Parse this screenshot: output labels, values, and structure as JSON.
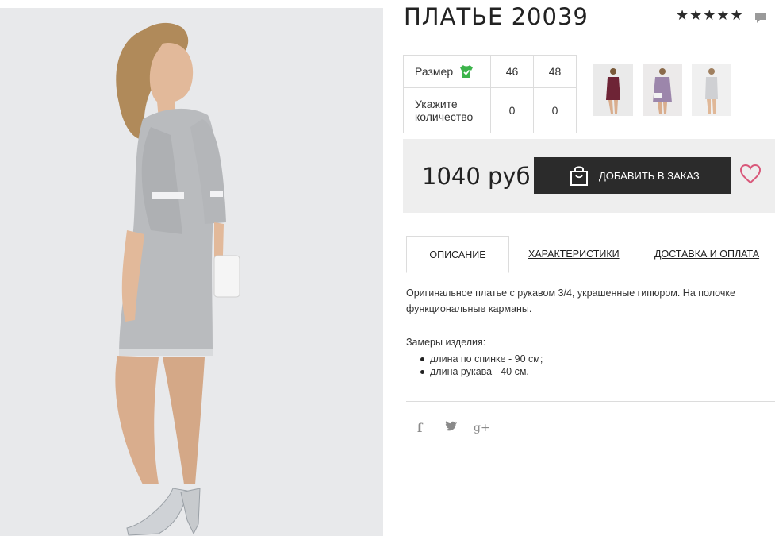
{
  "product": {
    "title": "ПЛАТЬЕ 20039",
    "rating_stars": "★★★★★",
    "rating_value": 5,
    "photo_icon": "model-in-grey-dress-photo"
  },
  "size_table": {
    "size_label": "Размер",
    "sizes": [
      "46",
      "48"
    ],
    "quantity_label": "Укажите количество",
    "quantities": [
      "0",
      "0"
    ]
  },
  "thumbnails": [
    {
      "icon": "burgundy-dress-thumbnail"
    },
    {
      "icon": "lilac-dress-thumbnail"
    },
    {
      "icon": "light-grey-dress-thumbnail"
    }
  ],
  "purchase": {
    "price": "1040 руб",
    "add_button_label": "ДОБАВИТЬ В ЗАКАЗ"
  },
  "tabs": [
    {
      "label": "ОПИСАНИЕ",
      "active": true
    },
    {
      "label": "ХАРАКТЕРИСТИКИ",
      "active": false
    },
    {
      "label": "ДОСТАВКА И ОПЛАТА",
      "active": false
    }
  ],
  "description": {
    "text": "Оригинальное платье с рукавом 3/4, украшенные гипюром. На полочке функциональные карманы.",
    "measures_title": "Замеры изделия:",
    "measures": [
      "длина по спинке - 90 см;",
      "длина рукава - 40 см."
    ]
  },
  "social": {
    "facebook": "f",
    "twitter": "twitter-icon",
    "gplus": "g+"
  },
  "colors": {
    "button_bg": "#2b2b2b",
    "price_bar_bg": "#eeeeee",
    "check_green": "#3cb44b",
    "heart_pink": "#d9587a"
  }
}
